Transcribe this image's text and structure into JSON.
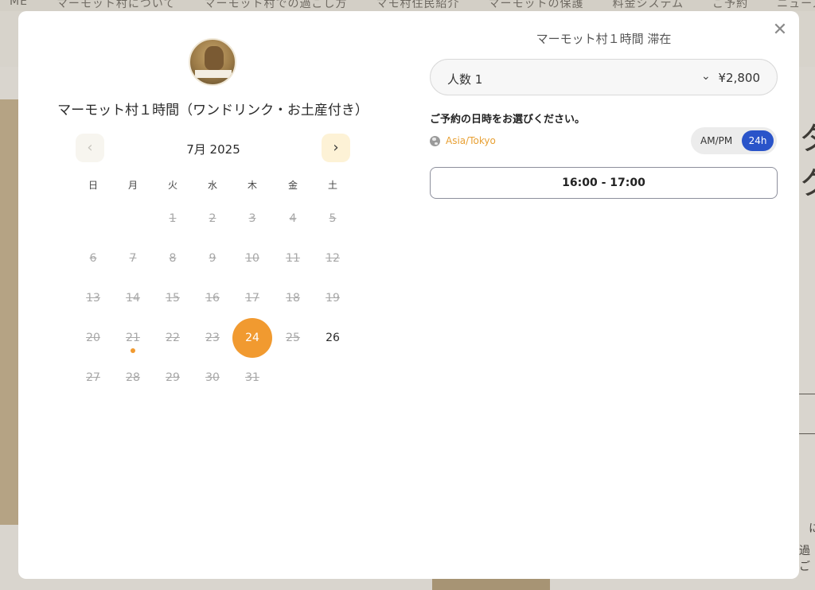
{
  "background": {
    "nav": [
      "ME",
      "マーモット村について",
      "マーモット村での過ごし方",
      "マモ村住民紹介",
      "マーモットの保護",
      "料金システム",
      "ご予約",
      "ニュース / イベ"
    ],
    "right_glyphs": [
      "タ",
      "ク"
    ],
    "right_small": [
      "に",
      "過ご"
    ]
  },
  "modal": {
    "close_glyph": "✕",
    "product": {
      "title": "マーモット村１時間（ワンドリンク・お土産付き）"
    },
    "calendar": {
      "prev_glyph": "‹",
      "next_glyph": "›",
      "month_label": "7月 2025",
      "weekdays": [
        "日",
        "月",
        "火",
        "水",
        "木",
        "金",
        "土"
      ],
      "days": [
        {
          "label": "1",
          "state": "past"
        },
        {
          "label": "2",
          "state": "past"
        },
        {
          "label": "3",
          "state": "past"
        },
        {
          "label": "4",
          "state": "past"
        },
        {
          "label": "5",
          "state": "past"
        },
        {
          "label": "6",
          "state": "past"
        },
        {
          "label": "7",
          "state": "past"
        },
        {
          "label": "8",
          "state": "past"
        },
        {
          "label": "9",
          "state": "past"
        },
        {
          "label": "10",
          "state": "past"
        },
        {
          "label": "11",
          "state": "past"
        },
        {
          "label": "12",
          "state": "past"
        },
        {
          "label": "13",
          "state": "past"
        },
        {
          "label": "14",
          "state": "past"
        },
        {
          "label": "15",
          "state": "past"
        },
        {
          "label": "16",
          "state": "past"
        },
        {
          "label": "17",
          "state": "past"
        },
        {
          "label": "18",
          "state": "past"
        },
        {
          "label": "19",
          "state": "past"
        },
        {
          "label": "20",
          "state": "past"
        },
        {
          "label": "21",
          "state": "past",
          "today": true
        },
        {
          "label": "22",
          "state": "past"
        },
        {
          "label": "23",
          "state": "past"
        },
        {
          "label": "24",
          "state": "selected"
        },
        {
          "label": "25",
          "state": "past"
        },
        {
          "label": "26",
          "state": "available"
        },
        {
          "label": "27",
          "state": "past"
        },
        {
          "label": "28",
          "state": "past"
        },
        {
          "label": "29",
          "state": "past"
        },
        {
          "label": "30",
          "state": "past"
        },
        {
          "label": "31",
          "state": "past"
        }
      ],
      "first_weekday_index": 2
    },
    "plan": {
      "title": "マーモット村１時間 滞在",
      "quantity_label": "人数 1",
      "price": "¥2,800",
      "prompt": "ご予約の日時をお選びください。",
      "timezone": "Asia/Tokyo",
      "format_ampm": "AM/PM",
      "format_24h": "24h",
      "slots": [
        "16:00 - 17:00"
      ]
    },
    "colors": {
      "accent": "#f19a30",
      "timezone": "#e8a033",
      "toggle_active": "#2a54c9"
    }
  }
}
